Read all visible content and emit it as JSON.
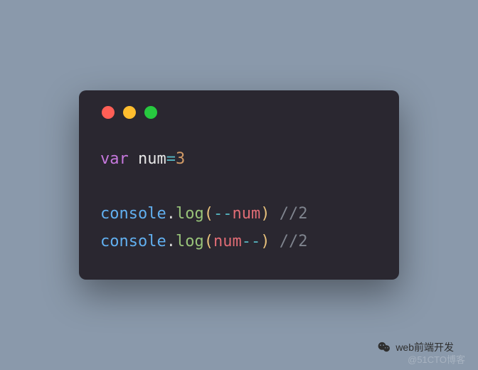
{
  "code": {
    "line1": {
      "keyword": "var",
      "identifier": "num",
      "operator": "=",
      "value": "3"
    },
    "line3": {
      "object": "console",
      "dot": ".",
      "method": "log",
      "lparen": "(",
      "arg_op": "--",
      "arg_ident": "num",
      "rparen": ")",
      "comment": "//2"
    },
    "line4": {
      "object": "console",
      "dot": ".",
      "method": "log",
      "lparen": "(",
      "arg_ident": "num",
      "arg_op": "--",
      "rparen": ")",
      "comment": "//2"
    }
  },
  "footer": {
    "credit": "web前端开发",
    "watermark": "@51CTO博客"
  }
}
